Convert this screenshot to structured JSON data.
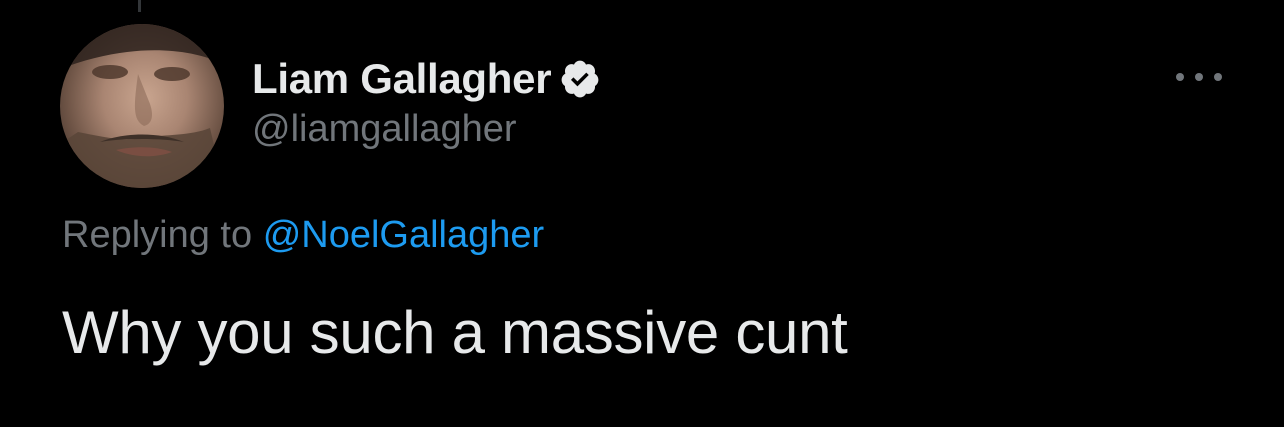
{
  "tweet": {
    "display_name": "Liam Gallagher",
    "handle": "@liamgallagher",
    "replying_prefix": "Replying to",
    "replying_to": "@NoelGallagher",
    "text": "Why you such a massive cunt",
    "verified": true
  },
  "icons": {
    "verified": "verified-badge-icon",
    "more": "more-options-icon",
    "avatar": "profile-photo"
  },
  "colors": {
    "background": "#000000",
    "primary_text": "#e7e9ea",
    "secondary_text": "#71767b",
    "link": "#1d9bf0"
  }
}
